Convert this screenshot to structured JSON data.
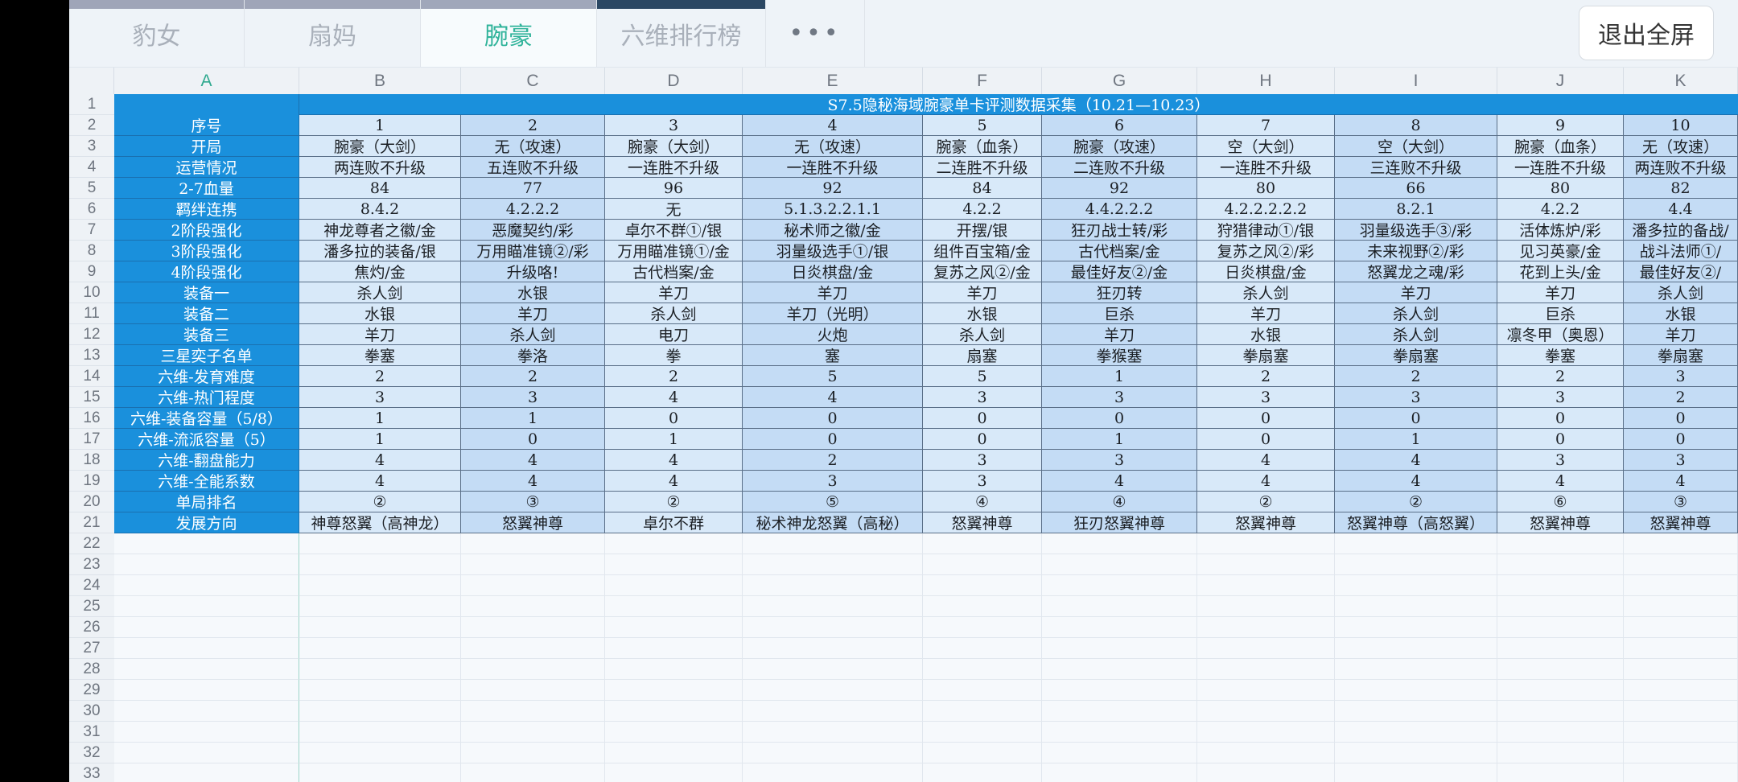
{
  "tabs": [
    {
      "label": "豹女"
    },
    {
      "label": "扇妈"
    },
    {
      "label": "腕豪"
    },
    {
      "label": "六维排行榜"
    }
  ],
  "more_label": "•••",
  "exit_label": "退出全屏",
  "columns": [
    "A",
    "B",
    "C",
    "D",
    "E",
    "F",
    "G",
    "H",
    "I",
    "J",
    "K"
  ],
  "row_numbers": [
    "1",
    "2",
    "3",
    "4",
    "5",
    "6",
    "7",
    "8",
    "9",
    "10",
    "11",
    "12",
    "13",
    "14",
    "15",
    "16",
    "17",
    "18",
    "19",
    "20",
    "21",
    "22",
    "23",
    "24",
    "25",
    "26",
    "27",
    "28",
    "29",
    "30",
    "31",
    "32",
    "33"
  ],
  "sheet_title": "S7.5隐秘海域腕豪单卡评测数据采集（10.21—10.23）",
  "rows": [
    {
      "label": "序号",
      "values": [
        "1",
        "2",
        "3",
        "4",
        "5",
        "6",
        "7",
        "8",
        "9",
        "10"
      ]
    },
    {
      "label": "开局",
      "values": [
        "腕豪（大剑）",
        "无（攻速）",
        "腕豪（大剑）",
        "无（攻速）",
        "腕豪（血条）",
        "腕豪（攻速）",
        "空（大剑）",
        "空（大剑）",
        "腕豪（血条）",
        "无（攻速）"
      ]
    },
    {
      "label": "运营情况",
      "values": [
        "两连败不升级",
        "五连败不升级",
        "一连胜不升级",
        "一连胜不升级",
        "二连胜不升级",
        "二连败不升级",
        "一连胜不升级",
        "三连败不升级",
        "一连胜不升级",
        "两连败不升级"
      ]
    },
    {
      "label": "2-7血量",
      "values": [
        "84",
        "77",
        "96",
        "92",
        "84",
        "92",
        "80",
        "66",
        "80",
        "82"
      ]
    },
    {
      "label": "羁绊连携",
      "values": [
        "8.4.2",
        "4.2.2.2",
        "无",
        "5.1.3.2.2.1.1",
        "4.2.2",
        "4.4.2.2.2",
        "4.2.2.2.2.2",
        "8.2.1",
        "4.2.2",
        "4.4"
      ]
    },
    {
      "label": "2阶段强化",
      "values": [
        "神龙尊者之徽/金",
        "恶魔契约/彩",
        "卓尔不群①/银",
        "秘术师之徽/金",
        "开摆/银",
        "狂刃战士转/彩",
        "狩猎律动①/银",
        "羽量级选手③/彩",
        "活体炼炉/彩",
        "潘多拉的备战/"
      ]
    },
    {
      "label": "3阶段强化",
      "values": [
        "潘多拉的装备/银",
        "万用瞄准镜②/彩",
        "万用瞄准镜①/金",
        "羽量级选手①/银",
        "组件百宝箱/金",
        "古代档案/金",
        "复苏之风②/彩",
        "未来视野②/彩",
        "见习英豪/金",
        "战斗法师①/"
      ]
    },
    {
      "label": "4阶段强化",
      "values": [
        "焦灼/金",
        "升级咯!",
        "古代档案/金",
        "日炎棋盘/金",
        "复苏之风②/金",
        "最佳好友②/金",
        "日炎棋盘/金",
        "怒翼龙之魂/彩",
        "花到上头/金",
        "最佳好友②/"
      ]
    },
    {
      "label": "装备一",
      "values": [
        "杀人剑",
        "水银",
        "羊刀",
        "羊刀",
        "羊刀",
        "狂刃转",
        "杀人剑",
        "羊刀",
        "羊刀",
        "杀人剑"
      ]
    },
    {
      "label": "装备二",
      "values": [
        "水银",
        "羊刀",
        "杀人剑",
        "羊刀（光明）",
        "水银",
        "巨杀",
        "羊刀",
        "杀人剑",
        "巨杀",
        "水银"
      ]
    },
    {
      "label": "装备三",
      "values": [
        "羊刀",
        "杀人剑",
        "电刀",
        "火炮",
        "杀人剑",
        "羊刀",
        "水银",
        "杀人剑",
        "凛冬甲（奥恩）",
        "羊刀"
      ]
    },
    {
      "label": "三星奕子名单",
      "values": [
        "拳塞",
        "拳洛",
        "拳",
        "塞",
        "扇塞",
        "拳猴塞",
        "拳扇塞",
        "拳扇塞",
        "拳塞",
        "拳扇塞"
      ]
    },
    {
      "label": "六维-发育难度",
      "values": [
        "2",
        "2",
        "2",
        "5",
        "5",
        "1",
        "2",
        "2",
        "2",
        "3"
      ]
    },
    {
      "label": "六维-热门程度",
      "values": [
        "3",
        "3",
        "4",
        "4",
        "3",
        "3",
        "3",
        "3",
        "3",
        "2"
      ]
    },
    {
      "label": "六维-装备容量（5/8）",
      "values": [
        "1",
        "1",
        "0",
        "0",
        "0",
        "0",
        "0",
        "0",
        "0",
        "0"
      ]
    },
    {
      "label": "六维-流派容量（5）",
      "values": [
        "1",
        "0",
        "1",
        "0",
        "0",
        "1",
        "0",
        "1",
        "0",
        "0"
      ]
    },
    {
      "label": "六维-翻盘能力",
      "values": [
        "4",
        "4",
        "4",
        "2",
        "3",
        "3",
        "4",
        "4",
        "3",
        "3"
      ]
    },
    {
      "label": "六维-全能系数",
      "values": [
        "4",
        "4",
        "4",
        "3",
        "3",
        "4",
        "4",
        "4",
        "4",
        "4"
      ]
    },
    {
      "label": "单局排名",
      "values": [
        "②",
        "③",
        "②",
        "⑤",
        "④",
        "④",
        "②",
        "②",
        "⑥",
        "③"
      ]
    },
    {
      "label": "发展方向",
      "values": [
        "神尊怒翼（高神龙）",
        "怒翼神尊",
        "卓尔不群",
        "秘术神龙怒翼（高秘）",
        "怒翼神尊",
        "狂刃怒翼神尊",
        "怒翼神尊",
        "怒翼神尊（高怒翼）",
        "怒翼神尊",
        "怒翼神尊"
      ]
    }
  ]
}
